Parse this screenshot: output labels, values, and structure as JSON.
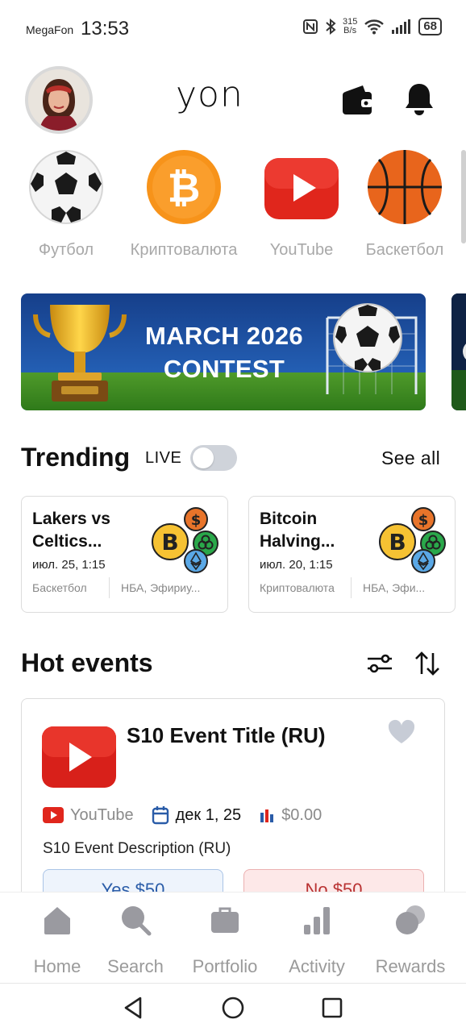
{
  "status_bar": {
    "carrier": "MegaFon",
    "time": "13:53",
    "net_speed_value": "315",
    "net_speed_unit": "B/s",
    "battery": "68"
  },
  "header": {
    "logo": "yon",
    "wallet_icon": "wallet-icon",
    "bell_icon": "bell-icon"
  },
  "categories": [
    {
      "label": "Футбол",
      "icon": "soccer-ball-icon"
    },
    {
      "label": "Криптовалюта",
      "icon": "bitcoin-icon"
    },
    {
      "label": "YouTube",
      "icon": "youtube-icon"
    },
    {
      "label": "Баскетбол",
      "icon": "basketball-icon"
    }
  ],
  "banner": {
    "line1": "MARCH 2026",
    "line2": "CONTEST"
  },
  "trending": {
    "title": "Trending",
    "live_label": "LIVE",
    "live_enabled": false,
    "see_all": "See all",
    "cards": [
      {
        "title": "Lakers vs Celtics...",
        "date": "июл. 25, 1:15",
        "category": "Баскетбол",
        "tags": "НБА, Эфириу..."
      },
      {
        "title": "Bitcoin Halving...",
        "date": "июл. 20, 1:15",
        "category": "Криптовалюта",
        "tags": "НБА, Эфи..."
      }
    ]
  },
  "hot_events": {
    "title": "Hot events",
    "filter_icon": "filter-icon",
    "sort_icon": "sort-icon",
    "event": {
      "title": "S10 Event Title (RU)",
      "source": "YouTube",
      "date": "дек 1, 25",
      "amount": "$0.00",
      "description": "S10 Event Description (RU)",
      "yes_label": "Yes $50",
      "no_label": "No $50"
    }
  },
  "bottom_nav": [
    {
      "label": "Home",
      "icon": "home-icon"
    },
    {
      "label": "Search",
      "icon": "search-icon"
    },
    {
      "label": "Portfolio",
      "icon": "briefcase-icon"
    },
    {
      "label": "Activity",
      "icon": "activity-icon"
    },
    {
      "label": "Rewards",
      "icon": "rewards-icon"
    }
  ],
  "colors": {
    "accent_blue": "#2a5ca8",
    "no_red": "#b93232",
    "youtube_red": "#e0261c",
    "bitcoin_orange": "#f7931a"
  }
}
